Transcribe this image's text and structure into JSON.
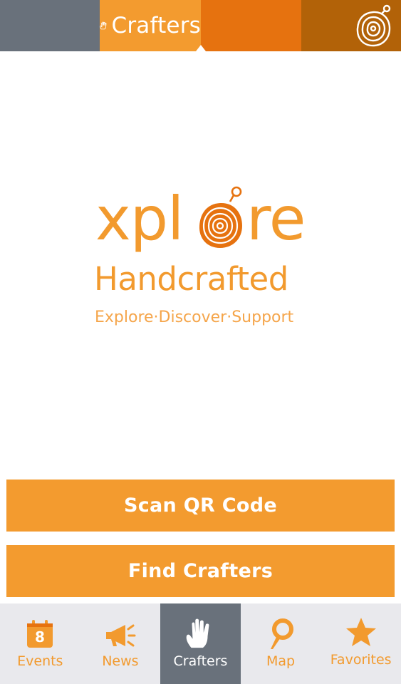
{
  "header": {
    "title": "Crafters",
    "hand_icon": "hand-icon",
    "tree_icon": "tree-rings-icon"
  },
  "logo": {
    "word_start": "xpl",
    "word_end": "re",
    "line2": "Handcrafted",
    "tagline": "Explore·Discover·Support"
  },
  "buttons": {
    "scan": "Scan QR Code",
    "find": "Find Crafters"
  },
  "nav": {
    "items": [
      {
        "label": "Events",
        "icon": "calendar-icon",
        "badge": "8"
      },
      {
        "label": "News",
        "icon": "megaphone-icon"
      },
      {
        "label": "Crafters",
        "icon": "hand-icon"
      },
      {
        "label": "Map",
        "icon": "map-pin-icon"
      },
      {
        "label": "Favorites",
        "icon": "star-icon"
      }
    ]
  },
  "colors": {
    "accent": "#f39b2f",
    "header_gray": "#69717b",
    "header_orange": "#e6720f",
    "header_brown": "#b26208",
    "nav_bg": "#e9e9ed"
  }
}
